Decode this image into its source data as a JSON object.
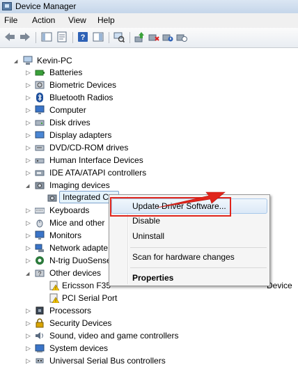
{
  "window": {
    "title": "Device Manager"
  },
  "menu": [
    "File",
    "Action",
    "View",
    "Help"
  ],
  "toolbar_icons": [
    "back-icon",
    "forward-icon",
    "properties-icon",
    "console-tree-icon",
    "help-icon",
    "action-pane-icon",
    "scan-hardware-icon",
    "update-driver-icon",
    "uninstall-icon",
    "disable-icon"
  ],
  "tree": {
    "root": "Kevin-PC",
    "items": [
      "Batteries",
      "Biometric Devices",
      "Bluetooth Radios",
      "Computer",
      "Disk drives",
      "Display adapters",
      "DVD/CD-ROM drives",
      "Human Interface Devices",
      "IDE ATA/ATAPI controllers",
      "Imaging devices",
      "Integrated C",
      "Keyboards",
      "Mice and other",
      "Monitors",
      "Network adapte",
      "N-trig DuoSense",
      "Other devices",
      "Ericsson F35",
      "PCI Serial Port",
      "Processors",
      "Security Devices",
      "Sound, video and game controllers",
      "System devices",
      "Universal Serial Bus controllers"
    ],
    "ericsson_tail": "Device"
  },
  "context_menu": {
    "items": [
      "Update Driver Software...",
      "Disable",
      "Uninstall",
      "Scan for hardware changes",
      "Properties"
    ]
  },
  "colors": {
    "highlight_box": "#e0251c",
    "arrow": "#e0251c",
    "selection": "#e5f3fb"
  }
}
